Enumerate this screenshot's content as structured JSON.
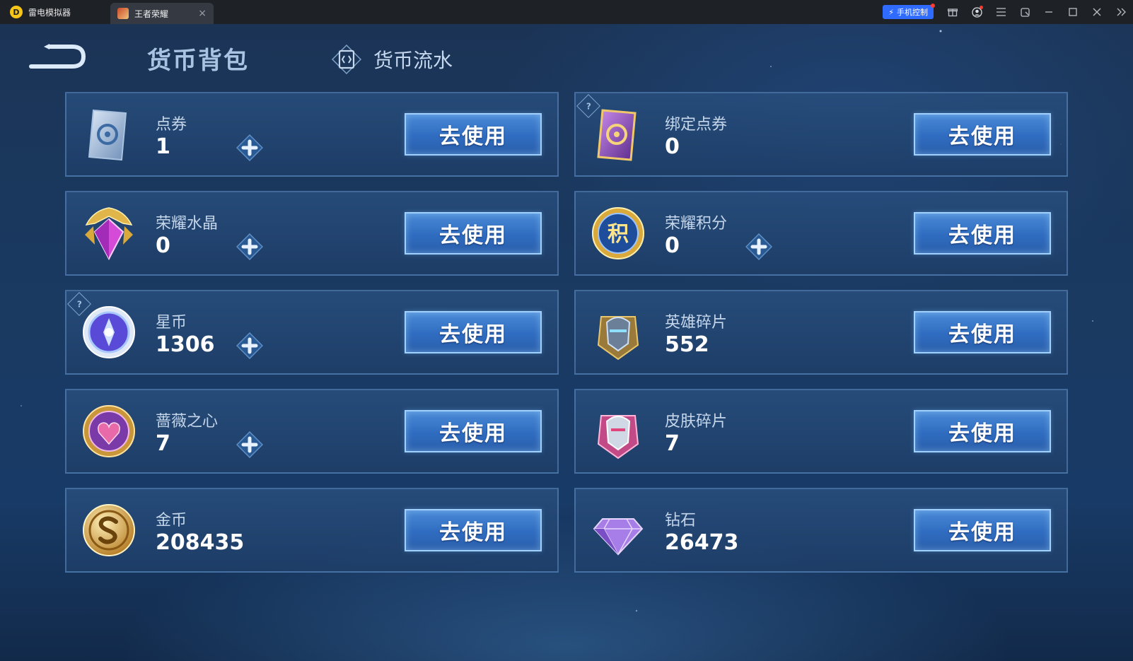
{
  "emulator": {
    "app_name": "雷电模拟器",
    "tab_label": "王者荣耀",
    "phone_control_label": "手机控制"
  },
  "header": {
    "title": "货币背包",
    "flow_label": "货币流水"
  },
  "use_button_label": "去使用",
  "currencies": [
    {
      "name": "点券",
      "amount": "1",
      "icon": "coupon-icon",
      "has_plus": true,
      "has_help": false
    },
    {
      "name": "绑定点券",
      "amount": "0",
      "icon": "bound-coupon-icon",
      "has_plus": false,
      "has_help": true
    },
    {
      "name": "荣耀水晶",
      "amount": "0",
      "icon": "glory-crystal-icon",
      "has_plus": true,
      "has_help": false
    },
    {
      "name": "荣耀积分",
      "amount": "0",
      "icon": "glory-points-icon",
      "has_plus": true,
      "has_help": false
    },
    {
      "name": "星币",
      "amount": "1306",
      "icon": "star-coin-icon",
      "has_plus": true,
      "has_help": true
    },
    {
      "name": "英雄碎片",
      "amount": "552",
      "icon": "hero-fragment-icon",
      "has_plus": false,
      "has_help": false
    },
    {
      "name": "蔷薇之心",
      "amount": "7",
      "icon": "rose-heart-icon",
      "has_plus": true,
      "has_help": false
    },
    {
      "name": "皮肤碎片",
      "amount": "7",
      "icon": "skin-fragment-icon",
      "has_plus": false,
      "has_help": false
    },
    {
      "name": "金币",
      "amount": "208435",
      "icon": "gold-coin-icon",
      "has_plus": false,
      "has_help": false
    },
    {
      "name": "钻石",
      "amount": "26473",
      "icon": "diamond-icon",
      "has_plus": false,
      "has_help": false
    }
  ],
  "points_icon_glyph": "积",
  "help_glyph": "?"
}
